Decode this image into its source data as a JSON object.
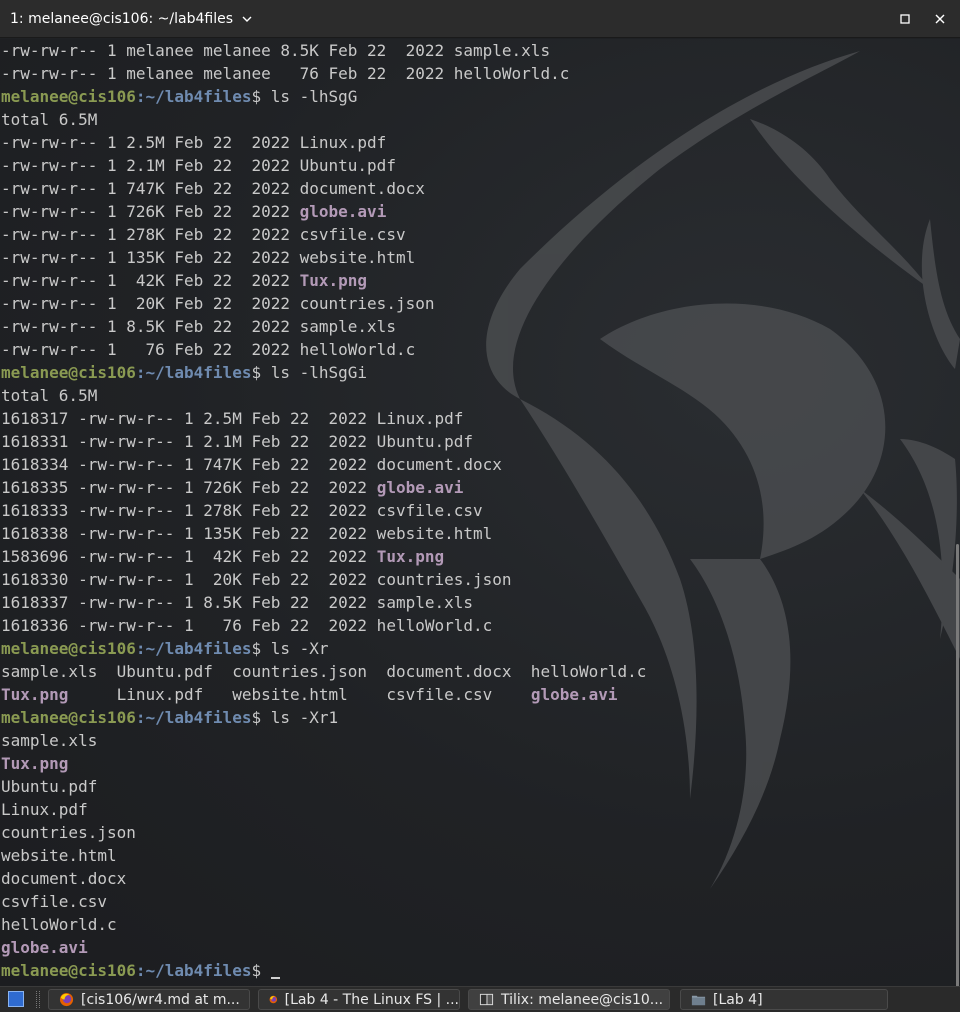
{
  "window": {
    "title": "1: melanee@cis106: ~/lab4files"
  },
  "terminal": {
    "prompt_user_host": "melanee@cis106",
    "prompt_path": ":~/lab4files",
    "prompt_symbol": "$ ",
    "lines": [
      {
        "type": "text",
        "text": "-rw-rw-r-- 1 melanee melanee 8.5K Feb 22  2022 sample.xls"
      },
      {
        "type": "text",
        "text": "-rw-rw-r-- 1 melanee melanee   76 Feb 22  2022 helloWorld.c"
      },
      {
        "type": "prompt",
        "cmd": "ls -lhSgG"
      },
      {
        "type": "text",
        "text": "total 6.5M"
      },
      {
        "type": "text",
        "text": "-rw-rw-r-- 1 2.5M Feb 22  2022 Linux.pdf"
      },
      {
        "type": "text",
        "text": "-rw-rw-r-- 1 2.1M Feb 22  2022 Ubuntu.pdf"
      },
      {
        "type": "text",
        "text": "-rw-rw-r-- 1 747K Feb 22  2022 document.docx"
      },
      {
        "type": "file",
        "prefix": "-rw-rw-r-- 1 726K Feb 22  2022 ",
        "name": "globe.avi",
        "kind": "vid"
      },
      {
        "type": "text",
        "text": "-rw-rw-r-- 1 278K Feb 22  2022 csvfile.csv"
      },
      {
        "type": "text",
        "text": "-rw-rw-r-- 1 135K Feb 22  2022 website.html"
      },
      {
        "type": "file",
        "prefix": "-rw-rw-r-- 1  42K Feb 22  2022 ",
        "name": "Tux.png",
        "kind": "img"
      },
      {
        "type": "text",
        "text": "-rw-rw-r-- 1  20K Feb 22  2022 countries.json"
      },
      {
        "type": "text",
        "text": "-rw-rw-r-- 1 8.5K Feb 22  2022 sample.xls"
      },
      {
        "type": "text",
        "text": "-rw-rw-r-- 1   76 Feb 22  2022 helloWorld.c"
      },
      {
        "type": "prompt",
        "cmd": "ls -lhSgGi"
      },
      {
        "type": "text",
        "text": "total 6.5M"
      },
      {
        "type": "text",
        "text": "1618317 -rw-rw-r-- 1 2.5M Feb 22  2022 Linux.pdf"
      },
      {
        "type": "text",
        "text": "1618331 -rw-rw-r-- 1 2.1M Feb 22  2022 Ubuntu.pdf"
      },
      {
        "type": "text",
        "text": "1618334 -rw-rw-r-- 1 747K Feb 22  2022 document.docx"
      },
      {
        "type": "file",
        "prefix": "1618335 -rw-rw-r-- 1 726K Feb 22  2022 ",
        "name": "globe.avi",
        "kind": "vid"
      },
      {
        "type": "text",
        "text": "1618333 -rw-rw-r-- 1 278K Feb 22  2022 csvfile.csv"
      },
      {
        "type": "text",
        "text": "1618338 -rw-rw-r-- 1 135K Feb 22  2022 website.html"
      },
      {
        "type": "file",
        "prefix": "1583696 -rw-rw-r-- 1  42K Feb 22  2022 ",
        "name": "Tux.png",
        "kind": "img"
      },
      {
        "type": "text",
        "text": "1618330 -rw-rw-r-- 1  20K Feb 22  2022 countries.json"
      },
      {
        "type": "text",
        "text": "1618337 -rw-rw-r-- 1 8.5K Feb 22  2022 sample.xls"
      },
      {
        "type": "text",
        "text": "1618336 -rw-rw-r-- 1   76 Feb 22  2022 helloWorld.c"
      },
      {
        "type": "prompt",
        "cmd": "ls -Xr"
      },
      {
        "type": "text",
        "text": "sample.xls  Ubuntu.pdf  countries.json  document.docx  helloWorld.c"
      },
      {
        "type": "mixed",
        "parts": [
          {
            "text": "Tux.png",
            "kind": "img"
          },
          {
            "text": "     Linux.pdf   website.html    csvfile.csv    ",
            "kind": ""
          },
          {
            "text": "globe.avi",
            "kind": "vid"
          }
        ]
      },
      {
        "type": "prompt",
        "cmd": "ls -Xr1"
      },
      {
        "type": "text",
        "text": "sample.xls"
      },
      {
        "type": "file",
        "prefix": "",
        "name": "Tux.png",
        "kind": "img"
      },
      {
        "type": "text",
        "text": "Ubuntu.pdf"
      },
      {
        "type": "text",
        "text": "Linux.pdf"
      },
      {
        "type": "text",
        "text": "countries.json"
      },
      {
        "type": "text",
        "text": "website.html"
      },
      {
        "type": "text",
        "text": "document.docx"
      },
      {
        "type": "text",
        "text": "csvfile.csv"
      },
      {
        "type": "text",
        "text": "helloWorld.c"
      },
      {
        "type": "file",
        "prefix": "",
        "name": "globe.avi",
        "kind": "vid"
      },
      {
        "type": "prompt",
        "cmd": "",
        "cursor": true
      }
    ]
  },
  "taskbar": {
    "items": [
      {
        "label": "[cis106/wr4.md at m...",
        "icon": "firefox-icon",
        "active": false
      },
      {
        "label": "[Lab 4 - The Linux FS | ...",
        "icon": "firefox-icon",
        "active": false
      },
      {
        "label": "Tilix: melanee@cis10...",
        "icon": "tilix-icon",
        "active": true
      },
      {
        "label": "[Lab 4]",
        "icon": "folder-icon",
        "active": false
      }
    ]
  },
  "colors": {
    "user": "#8a9a52",
    "path": "#6f8bb0",
    "special_file": "#b39ab7",
    "text": "#c9c9c9"
  }
}
